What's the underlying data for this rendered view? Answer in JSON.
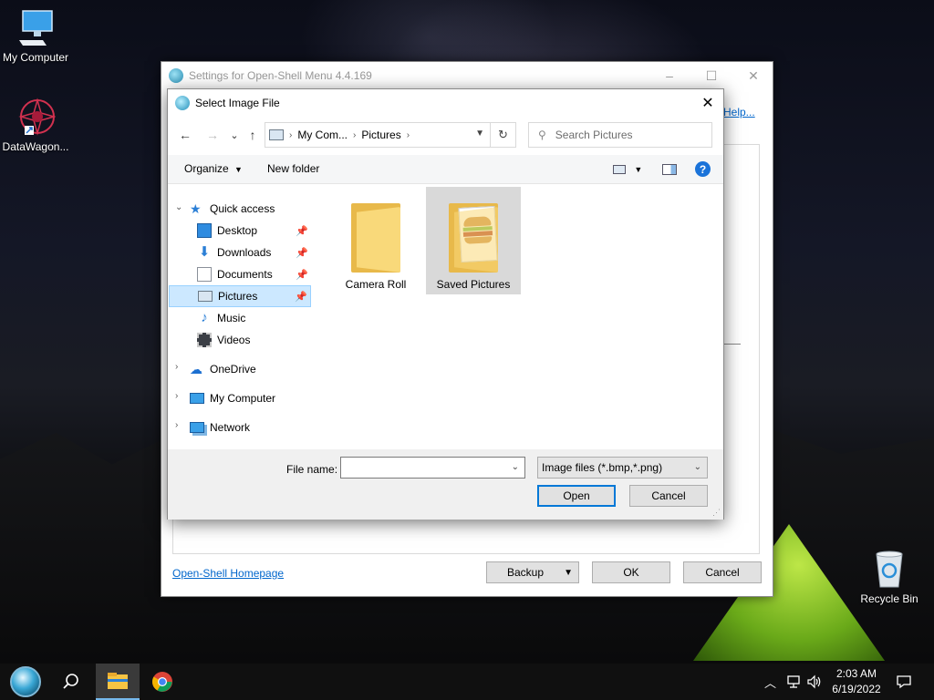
{
  "desktop": {
    "icons": [
      {
        "label": "My Computer"
      },
      {
        "label": "DataWagon..."
      },
      {
        "label": "Recycle Bin"
      }
    ]
  },
  "settings_window": {
    "title": "Settings for Open-Shell Menu 4.4.169",
    "help_link": "Help...",
    "homepage_link": "Open-Shell Homepage",
    "backup_label": "Backup",
    "ok_label": "OK",
    "cancel_label": "Cancel",
    "minimize": "–",
    "maximize": "☐",
    "close": "✕"
  },
  "dialog": {
    "title": "Select Image File",
    "close": "✕",
    "nav": {
      "back": "←",
      "forward": "→",
      "recent": "⌄",
      "up": "↑"
    },
    "address": {
      "segments": [
        "My Com...",
        "Pictures"
      ],
      "refresh": "↻"
    },
    "search": {
      "placeholder": "Search Pictures"
    },
    "toolbar": {
      "organize": "Organize",
      "new_folder": "New folder",
      "help": "?"
    },
    "nav_pane": {
      "quick_access": "Quick access",
      "items": [
        {
          "label": "Desktop"
        },
        {
          "label": "Downloads"
        },
        {
          "label": "Documents"
        },
        {
          "label": "Pictures"
        },
        {
          "label": "Music"
        },
        {
          "label": "Videos"
        }
      ],
      "onedrive": "OneDrive",
      "my_computer": "My Computer",
      "network": "Network"
    },
    "folders": [
      {
        "label": "Camera Roll"
      },
      {
        "label": "Saved Pictures"
      }
    ],
    "bottom": {
      "file_name_label": "File name:",
      "file_name_value": "",
      "filter_value": "Image files (*.bmp,*.png)",
      "open_label": "Open",
      "cancel_label": "Cancel"
    }
  },
  "taskbar": {
    "time": "2:03 AM",
    "date": "6/19/2022"
  }
}
